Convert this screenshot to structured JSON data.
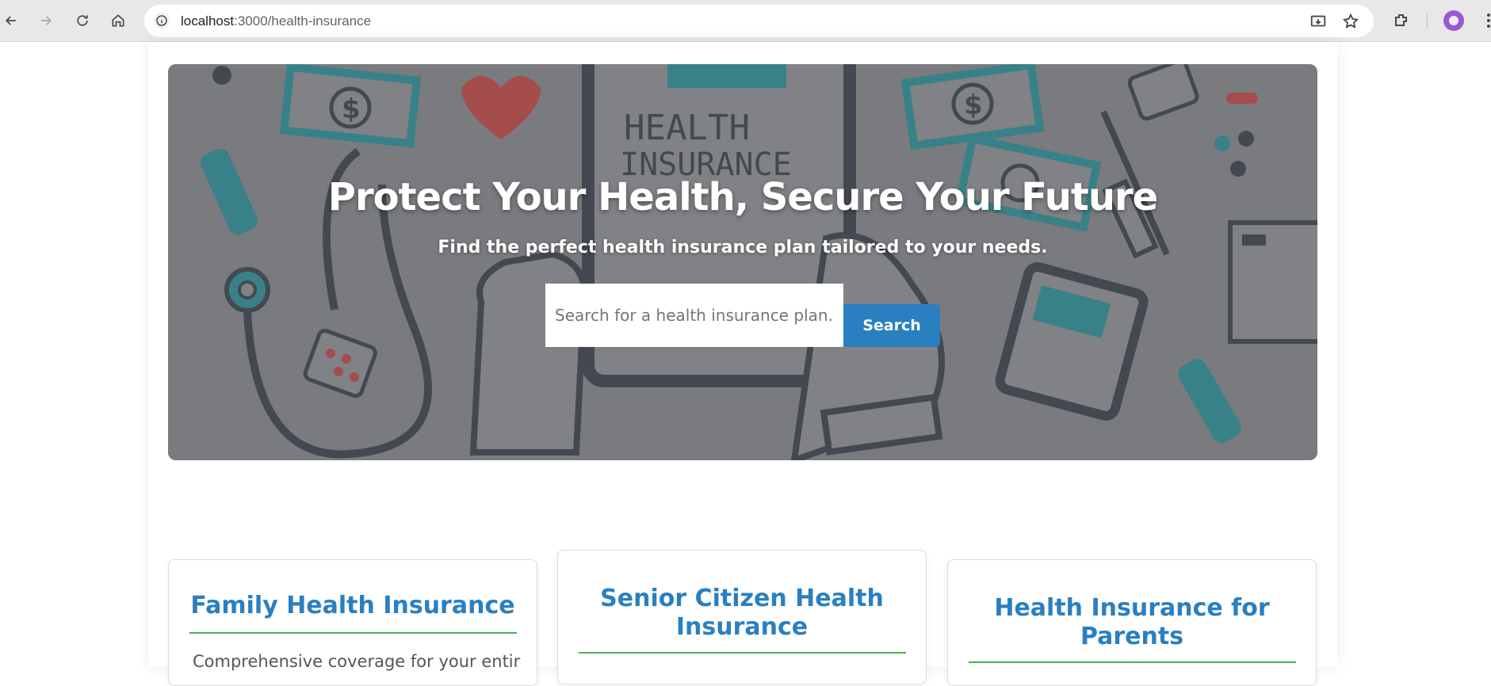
{
  "browser": {
    "url_host": "localhost",
    "url_path": ":3000/health-insurance"
  },
  "hero": {
    "title": "Protect Your Health, Secure Your Future",
    "subtitle": "Find the perfect health insurance plan tailored to your needs.",
    "search_placeholder": "Search for a health insurance plan.",
    "search_button": "Search",
    "art_text_line1": "HEALTH",
    "art_text_line2": "INSURANCE"
  },
  "cards": [
    {
      "title_line1": "Family Health Insurance",
      "title_line2": "",
      "description": "Comprehensive coverage for your entire"
    },
    {
      "title_line1": "Senior Citizen Health",
      "title_line2": "Insurance",
      "description": ""
    },
    {
      "title_line1": "Health Insurance for",
      "title_line2": "Parents",
      "description": ""
    }
  ],
  "colors": {
    "accent": "#2a7fc0",
    "divider": "#4caf50"
  }
}
